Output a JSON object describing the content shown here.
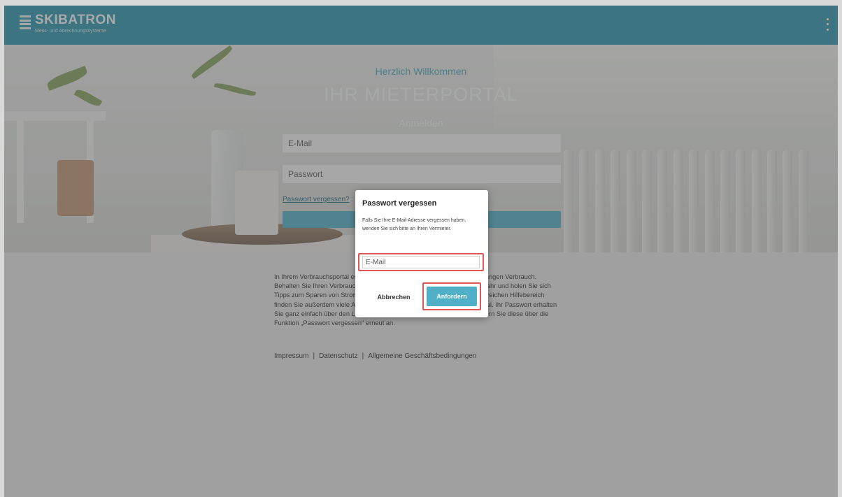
{
  "header": {
    "brand_name": "SKIBATRON",
    "brand_subtitle": "Mess- und Abrechnungssysteme",
    "menu_icon": "more-vertical-icon"
  },
  "hero": {
    "welcome": "Herzlich Willkommen",
    "title": "IHR MIETERPORTAL",
    "login_heading": "Anmelden",
    "email_placeholder": "E-Mail",
    "password_placeholder": "Passwort",
    "forgot_link": "Passwort vergessen?"
  },
  "info": {
    "text": "In Ihrem Verbrauchsportal erhalten Sie einen Überblick über Ihren unterjährigen Verbrauch. Behalten Sie Ihren Verbrauch im Blick, vergleichen Sie diese mit dem Vorjahr und holen Sie sich Tipps zum Sparen von Strom, Wasser oder Heizenergie. In einem umfangreichen Hilfebereich finden Sie außerdem viele Anleitungen und Erklärungen rund um das Portal. Ihr Passwort erhalten Sie ganz einfach über den Link aus Ihrer Aktivierungs-E-Mail an oder fordern Sie diese über die Funktion „Passwort vergessen\" erneut an."
  },
  "footer": {
    "impressum": "Impressum",
    "separator": "|",
    "datenschutz": "Datenschutz",
    "agb": "Allgemeine Geschäftsbedingungen"
  },
  "modal": {
    "title": "Passwort vergessen",
    "text": "Falls Sie Ihre E-Mail-Adresse vergessen haben, wenden Sie sich bitte an Ihren Vermieter.",
    "email_placeholder": "E-Mail",
    "cancel_label": "Abbrechen",
    "submit_label": "Anfordern"
  },
  "colors": {
    "header_bg": "#3e9eb4",
    "accent": "#4fb0c8",
    "highlight": "#e05555"
  }
}
